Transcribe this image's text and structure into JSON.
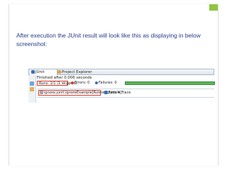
{
  "slide": {
    "body_text": "After execution the JUnit result will look like this as displaying in below screenshot:",
    "accent_color": "#8fc63f"
  },
  "eclipse": {
    "tabs": [
      {
        "label": "JUnit",
        "icon": "junit-icon"
      },
      {
        "label": "Project Explorer",
        "icon": "folder-icon"
      }
    ],
    "status": "Finished after 0.006 seconds",
    "runs": "Runs:  1/1 (1 skipped)",
    "errors_label": "Errors:",
    "errors_value": "0",
    "failures_label": "Failures:",
    "failures_value": "0",
    "progress": 1.0,
    "progress_color": "#5bb35a",
    "test_item": "ignore.junit.IgnoreExample[Runner: JUnit 4]",
    "failure_trace": "Failure Trace"
  }
}
